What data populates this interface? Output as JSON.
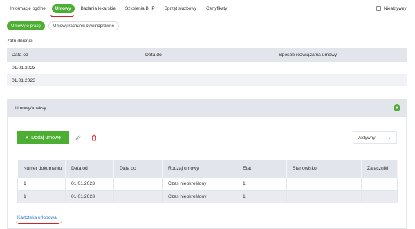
{
  "tabs": [
    {
      "label": "Informacje ogólne",
      "active": false
    },
    {
      "label": "Umowy",
      "active": true
    },
    {
      "label": "Badania lekarskie",
      "active": false
    },
    {
      "label": "Szkolenia BHP",
      "active": false
    },
    {
      "label": "Sprzęt służbowy",
      "active": false
    },
    {
      "label": "Certyfikaty",
      "active": false
    }
  ],
  "inactive_filter": {
    "label": "Nieaktywny",
    "checked": false
  },
  "subtabs": [
    {
      "label": "Umowy o pracę",
      "active": true
    },
    {
      "label": "Umowy/rachunki cywilnoprawne",
      "active": false
    }
  ],
  "employment": {
    "section_label": "Zatrudnienie",
    "columns": [
      "Data od",
      "Data do",
      "Sposób rozwiązania umowy"
    ],
    "rows": [
      [
        "01.01.2023",
        "",
        ""
      ],
      [
        "01.01.2023",
        "",
        ""
      ]
    ]
  },
  "contracts": {
    "panel_title": "Umowy/aneksy",
    "add_button": "Dodaj umowę",
    "status_select": "Aktywny",
    "columns": [
      "Numer dokumentu",
      "Data od",
      "Data do",
      "Rodzaj umowy",
      "Etat",
      "Stanowisko",
      "Załączniki"
    ],
    "rows": [
      [
        "1",
        "01.01.2023",
        "",
        "Czas nieokreślony",
        "1",
        "",
        ""
      ],
      [
        "1",
        "01.01.2023",
        "",
        "Czas nieokreślony",
        "1",
        "",
        ""
      ]
    ]
  },
  "leave_card_link": "Kartoteka urlopowa",
  "colors": {
    "accent": "#4caf34",
    "annotation": "#d32222",
    "link": "#2a6fcf",
    "header_bg": "#e3e5ec"
  }
}
